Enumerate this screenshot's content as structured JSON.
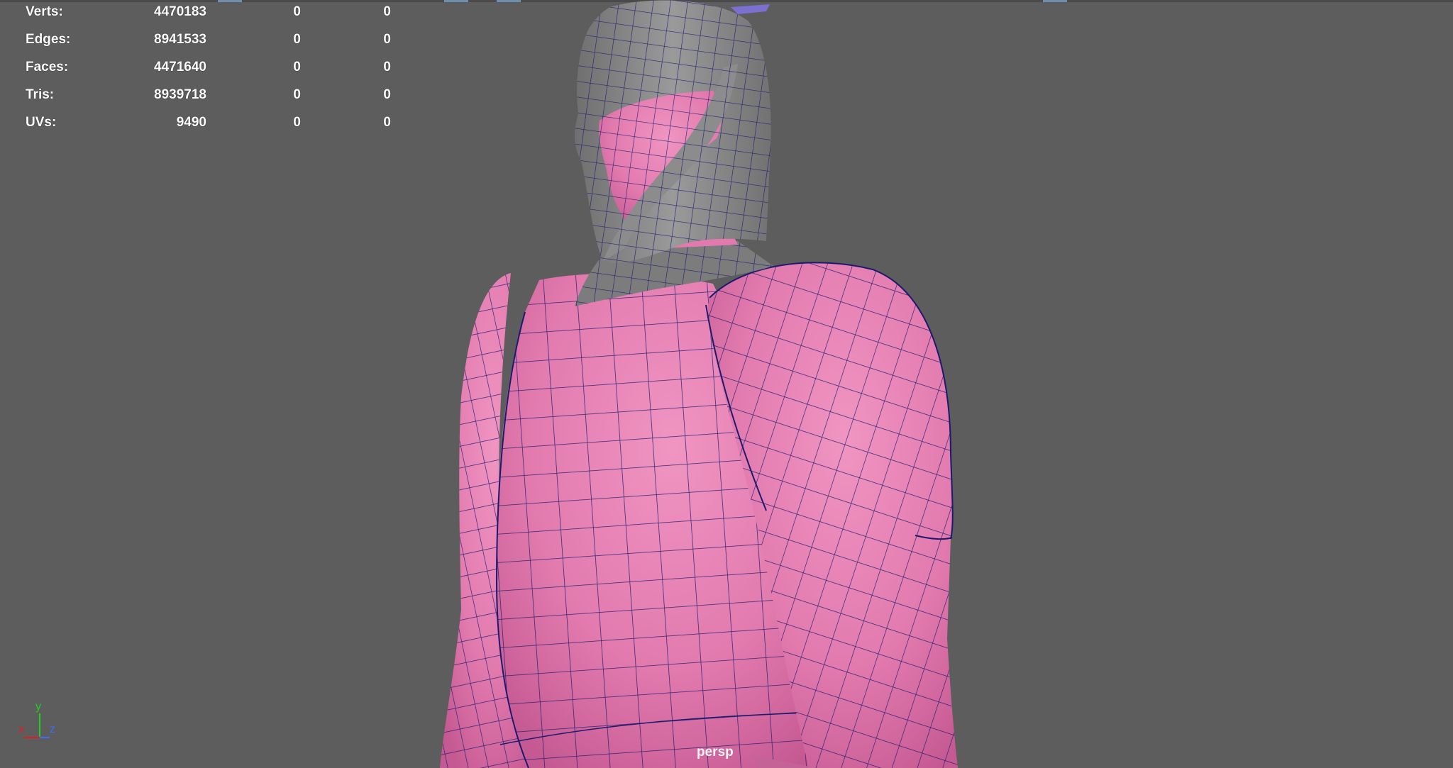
{
  "hud": {
    "rows": [
      {
        "label": "Verts:",
        "v1": "4470183",
        "v2": "0",
        "v3": "0"
      },
      {
        "label": "Edges:",
        "v1": "8941533",
        "v2": "0",
        "v3": "0"
      },
      {
        "label": "Faces:",
        "v1": "4471640",
        "v2": "0",
        "v3": "0"
      },
      {
        "label": "Tris:",
        "v1": "8939718",
        "v2": "0",
        "v3": "0"
      },
      {
        "label": "UVs:",
        "v1": "9490",
        "v2": "0",
        "v3": "0"
      }
    ]
  },
  "viewport": {
    "camera": "persp",
    "background_color": "#5d5d5d",
    "mesh_color": "#e27aae",
    "helmet_color": "#8a8a8a",
    "wire_color": "#1c1a6e"
  },
  "axis": {
    "x_label": "x",
    "y_label": "y",
    "z_label": "z",
    "x_color": "#e02020",
    "y_color": "#20d020",
    "z_color": "#3b6cff"
  }
}
